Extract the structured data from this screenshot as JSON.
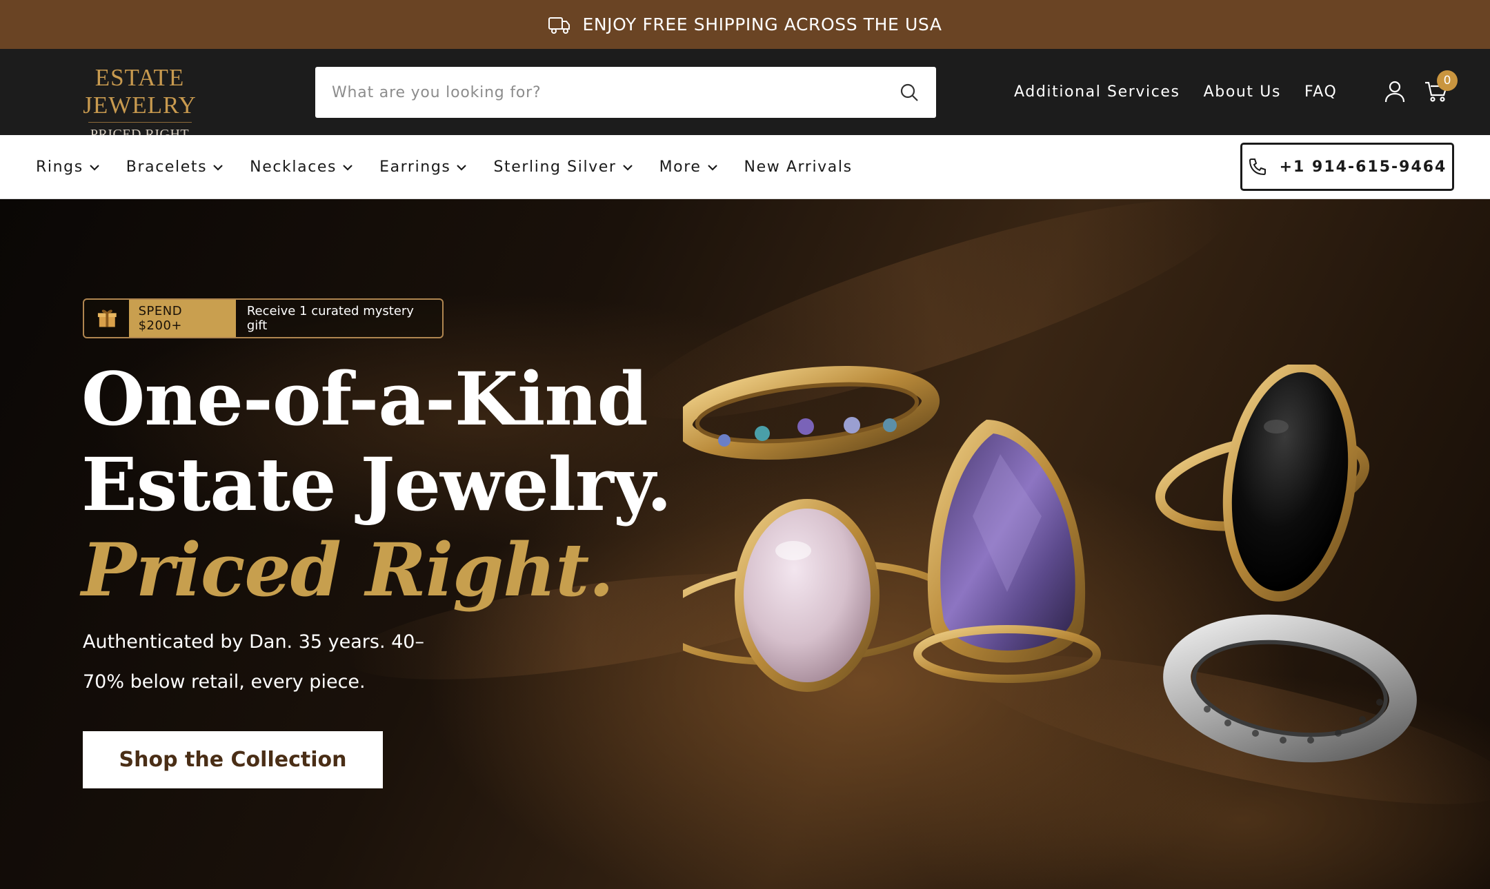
{
  "announcement": {
    "text": "ENJOY FREE SHIPPING ACROSS THE USA",
    "icon": "truck-icon"
  },
  "header": {
    "logo": {
      "line1": "ESTATE JEWELRY",
      "line2": "PRICED RIGHT"
    },
    "search": {
      "placeholder": "What are you looking for?",
      "icon": "search-icon"
    },
    "nav": [
      "Additional Services",
      "About Us",
      "FAQ"
    ],
    "cart_count": "0"
  },
  "categories": [
    {
      "label": "Rings",
      "dropdown": true
    },
    {
      "label": "Bracelets",
      "dropdown": true
    },
    {
      "label": "Necklaces",
      "dropdown": true
    },
    {
      "label": "Earrings",
      "dropdown": true
    },
    {
      "label": "Sterling Silver",
      "dropdown": true
    },
    {
      "label": "More",
      "dropdown": true
    },
    {
      "label": "New Arrivals",
      "dropdown": false
    }
  ],
  "phone": "+1 914-615-9464",
  "hero": {
    "promo_tag": "SPEND $200+",
    "promo_text": "Receive 1 curated mystery gift",
    "heading_line1": "One-of-a-Kind",
    "heading_line2": "Estate Jewelry.",
    "heading_line3": "Priced Right.",
    "subtitle_line1": "Authenticated by Dan. 35 years. 40–",
    "subtitle_line2": "70% below retail, every piece.",
    "cta_label": "Shop the Collection"
  },
  "colors": {
    "announce_bg": "#6a4424",
    "header_bg": "#1c1c1c",
    "gold": "#c79f4e",
    "cart_badge": "#c9953f"
  }
}
